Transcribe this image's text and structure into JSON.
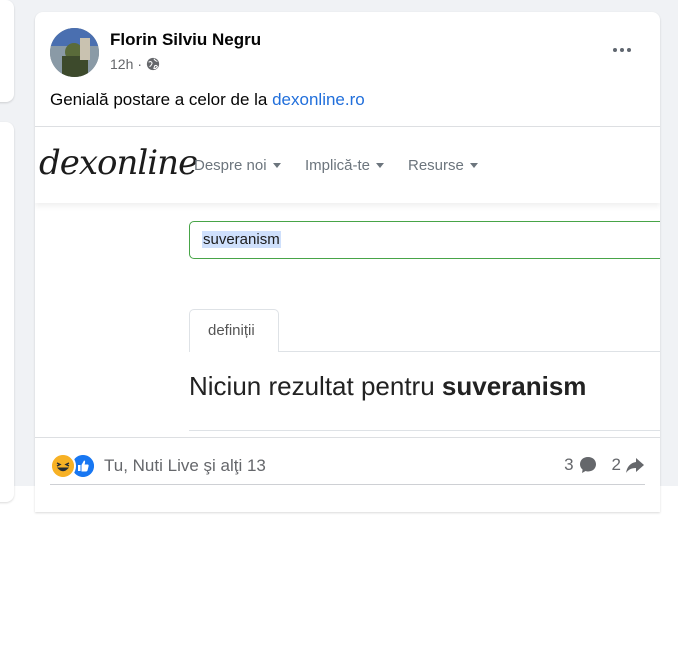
{
  "post": {
    "author": "Florin Silviu Negru",
    "time": "12h",
    "separator": "·",
    "text_prefix": "Genială postare a celor de la ",
    "text_link": "dexonline.ro",
    "shared_image": {
      "logo": "dexonline",
      "menu": [
        "Despre noi",
        "Implică-te",
        "Resurse"
      ],
      "search_value": "suveranism",
      "tab_label": "definiții",
      "result_prefix": "Niciun rezultat pentru ",
      "result_term": "suveranism"
    },
    "reactions": {
      "icons": [
        "haha-icon",
        "like-icon"
      ],
      "text": "Tu, Nuti Live şi alţi 13",
      "comments_count": "3",
      "shares_count": "2"
    }
  },
  "colors": {
    "link": "#216fdb",
    "like": "#1877f2",
    "haha": "#f7b125",
    "search_border": "#47a447"
  }
}
